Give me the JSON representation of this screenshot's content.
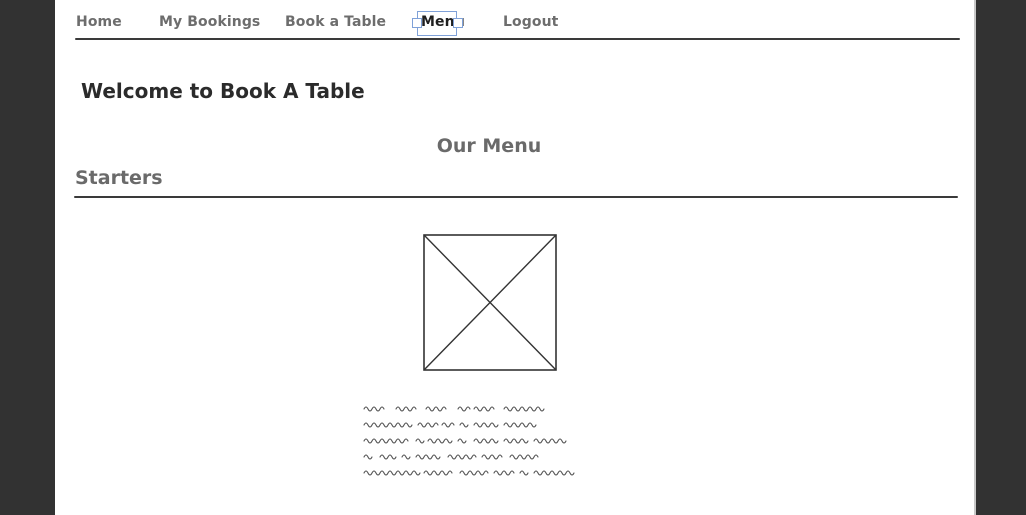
{
  "nav": {
    "items": [
      {
        "label": "Home"
      },
      {
        "label": "My Bookings"
      },
      {
        "label": "Book a Table"
      },
      {
        "label": "Menu",
        "active": true
      },
      {
        "label": "Logout"
      }
    ]
  },
  "page": {
    "welcome": "Welcome to Book A Table",
    "menu_title": "Our Menu",
    "section": "Starters"
  },
  "icons": {
    "image_placeholder": "image-placeholder-icon",
    "text_scribble": "text-scribble-icon"
  },
  "colors": {
    "background": "#323232",
    "canvas": "#ffffff",
    "text_dark": "#2b2b2b",
    "text_muted": "#6a6a6a",
    "selection": "#7fa1d8"
  }
}
